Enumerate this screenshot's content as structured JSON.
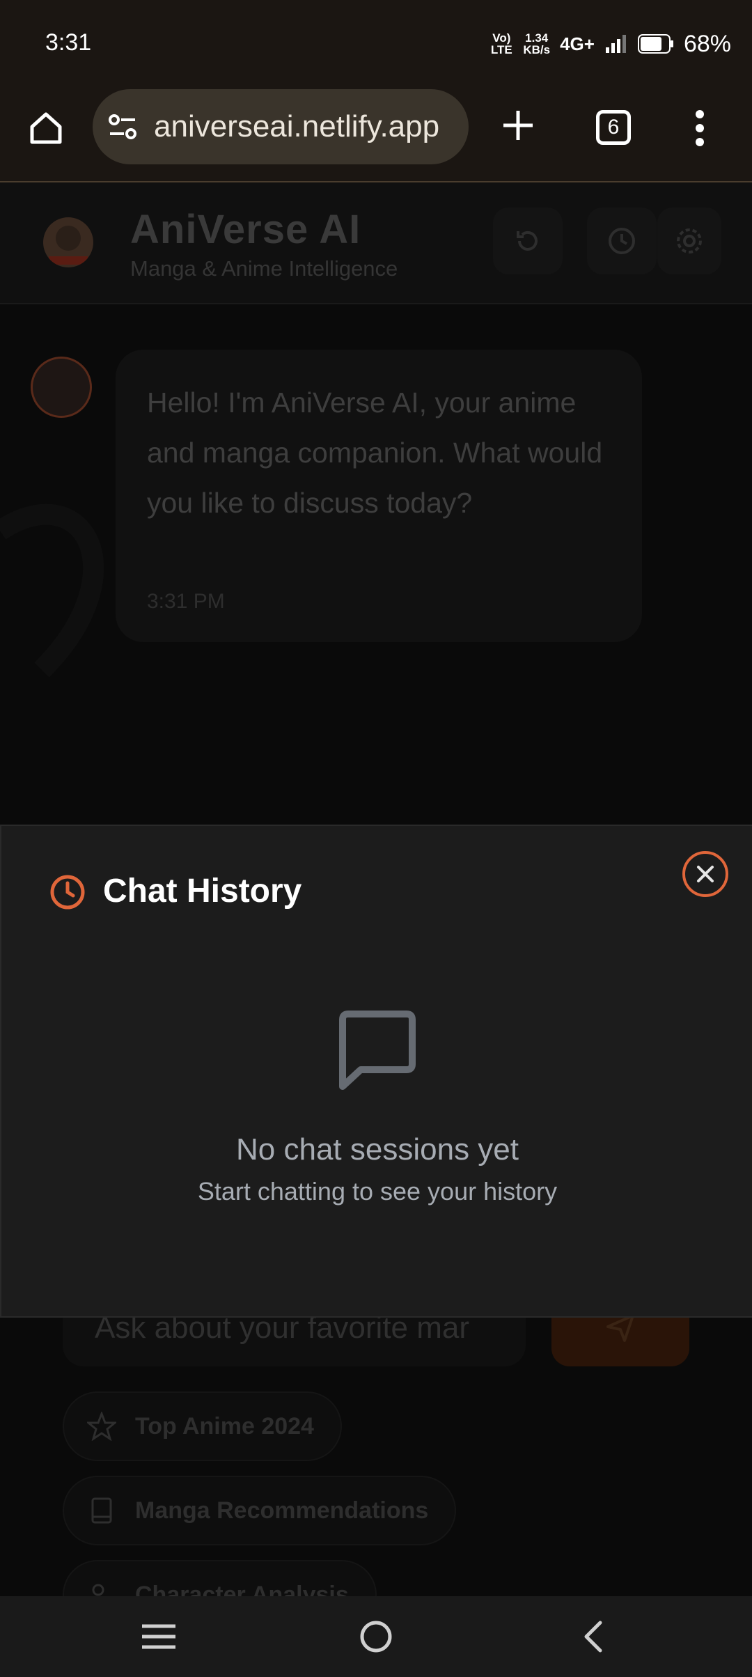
{
  "status_bar": {
    "time": "3:31",
    "volte": "Vo) LTE",
    "speed_value": "1.34",
    "speed_unit": "KB/s",
    "network": "4G+",
    "battery": "68%"
  },
  "browser": {
    "url": "aniverseai.netlify.app",
    "tab_count": "6"
  },
  "app": {
    "title": "AniVerse AI",
    "subtitle": "Manga & Anime Intelligence"
  },
  "chat": {
    "greeting": "Hello! I'm AniVerse AI, your anime and manga companion. What would you like to discuss today?",
    "time": "3:31 PM"
  },
  "input": {
    "placeholder": "Ask about your favorite mar"
  },
  "suggestions": [
    {
      "label": "Top Anime 2024"
    },
    {
      "label": "Manga Recommendations"
    },
    {
      "label": "Character Analysis"
    }
  ],
  "history_modal": {
    "title": "Chat History",
    "empty_title": "No chat sessions yet",
    "empty_subtitle": "Start chatting to see your history"
  },
  "colors": {
    "accent": "#e0663a",
    "modal_bg": "#1c1c1c",
    "muted_text": "#a7acb3"
  }
}
